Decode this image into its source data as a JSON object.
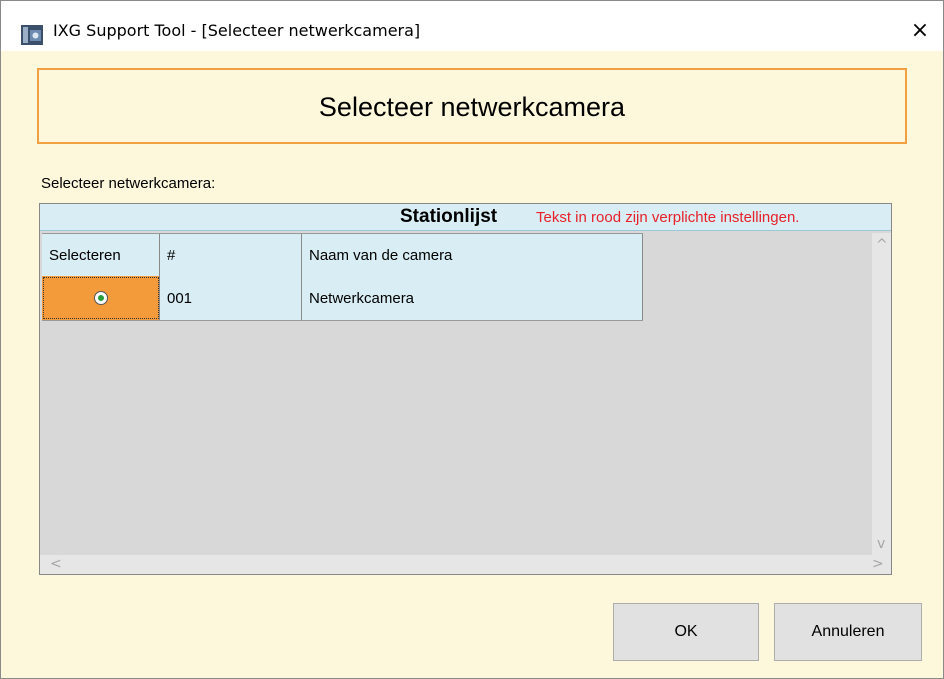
{
  "window": {
    "title": "IXG Support Tool - [Selecteer netwerkcamera]",
    "close_label": "×"
  },
  "banner": {
    "text": "Selecteer netwerkcamera"
  },
  "field_label": "Selecteer netwerkcamera:",
  "grid": {
    "caption_title": "Stationlijst",
    "caption_hint": "Tekst in rood zijn verplichte instellingen.",
    "columns": [
      "Selecteren",
      "#",
      "Naam van de camera"
    ],
    "rows": [
      {
        "selected": true,
        "number": "001",
        "name": "Netwerkcamera"
      }
    ]
  },
  "scroll": {
    "up": "^",
    "down": "v",
    "left": "<",
    "right": ">"
  },
  "buttons": {
    "ok": "OK",
    "cancel": "Annuleren"
  },
  "colors": {
    "accent_orange": "#f39a3a",
    "required_red": "#e8202a",
    "dialog_bg": "#fdf8dc",
    "grid_header": "#d9eef4"
  }
}
